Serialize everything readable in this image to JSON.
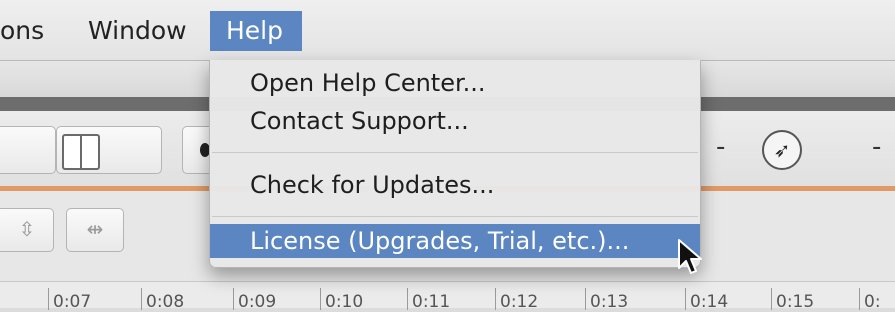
{
  "menubar": {
    "items": [
      {
        "label": "ons"
      },
      {
        "label": "Window"
      },
      {
        "label": "Help"
      }
    ]
  },
  "help_menu": {
    "items": [
      {
        "label": "Open Help Center..."
      },
      {
        "label": "Contact Support..."
      },
      {
        "label": "Check for Updates..."
      },
      {
        "label": "License (Upgrades, Trial, etc.)..."
      }
    ],
    "highlighted_index": 3
  },
  "toolbar": {
    "dash_left": "-",
    "dash_right": "-",
    "circle_icon": "navigate-arrow-icon"
  },
  "timeline": {
    "ticks": [
      "0:07",
      "0:08",
      "0:09",
      "0:10",
      "0:11",
      "0:12",
      "0:13",
      "0:14",
      "0:15",
      "0:"
    ]
  },
  "colors": {
    "menu_highlight": "#5b86c2",
    "accent_orange": "#e09a66"
  }
}
